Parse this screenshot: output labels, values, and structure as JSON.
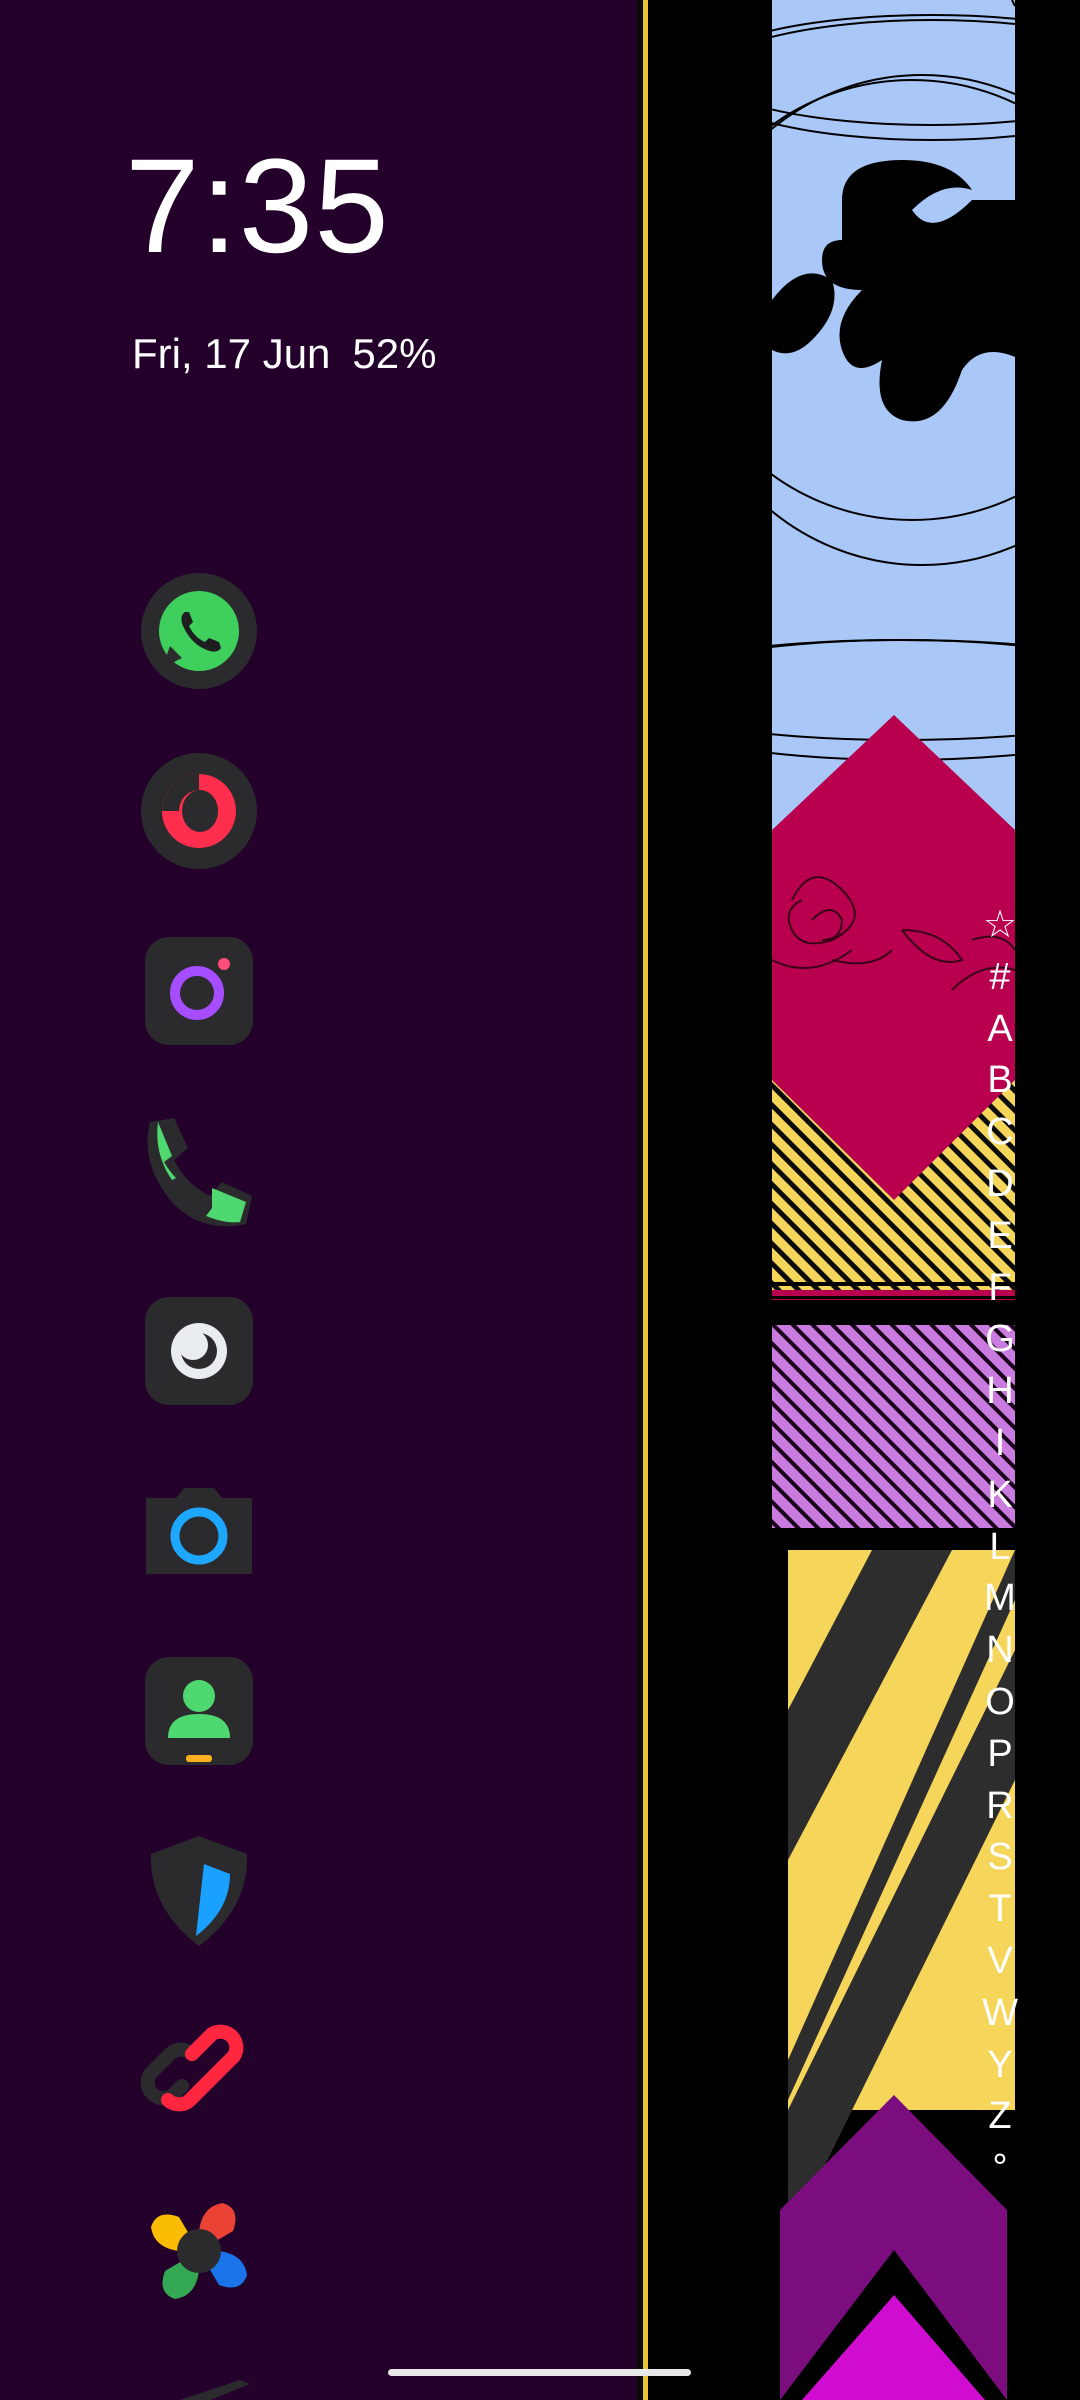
{
  "status": {
    "time": "7:35",
    "date": "Fri, 17 Jun",
    "battery": "52%"
  },
  "dock_apps": [
    {
      "name": "WhatsApp",
      "icon": "whatsapp-icon"
    },
    {
      "name": "Opera",
      "icon": "opera-icon"
    },
    {
      "name": "Instagram",
      "icon": "instagram-icon"
    },
    {
      "name": "Phone",
      "icon": "phone-icon"
    },
    {
      "name": "Camera Lens",
      "icon": "lens-icon"
    },
    {
      "name": "Camera",
      "icon": "camera-icon"
    },
    {
      "name": "Contacts",
      "icon": "contacts-icon"
    },
    {
      "name": "Security",
      "icon": "shield-icon"
    },
    {
      "name": "Link",
      "icon": "link-icon"
    },
    {
      "name": "Pinwheel",
      "icon": "pinwheel-icon"
    }
  ],
  "alphabet_index": [
    "☆",
    "#",
    "A",
    "B",
    "C",
    "D",
    "E",
    "F",
    "G",
    "H",
    "I",
    "K",
    "L",
    "M",
    "N",
    "O",
    "P",
    "R",
    "S",
    "T",
    "V",
    "W",
    "Y",
    "Z",
    "°"
  ],
  "colors": {
    "background": "#23012b",
    "divider": "#e9c23a",
    "wallpaper_blue": "#a9c8f7",
    "wallpaper_magenta": "#b8004f",
    "wallpaper_yellow": "#f5d65a",
    "wallpaper_lilac": "#c97be0",
    "wallpaper_purple": "#7b0d7f",
    "wallpaper_pink": "#d10cd1"
  }
}
